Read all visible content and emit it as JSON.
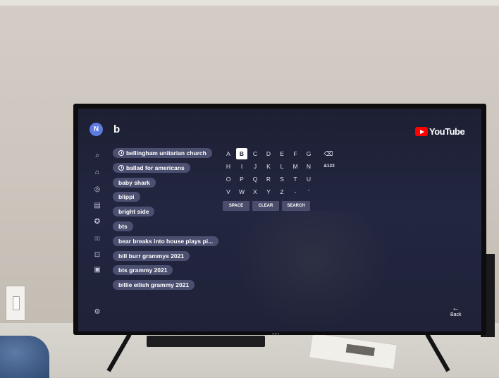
{
  "app": {
    "name": "YouTube",
    "avatar_initial": "N",
    "query": "b",
    "accent": "#ff0000"
  },
  "nav": [
    {
      "name": "search-icon",
      "glyph": "⌕"
    },
    {
      "name": "home-icon",
      "glyph": "⌂"
    },
    {
      "name": "explore-icon",
      "glyph": "◎"
    },
    {
      "name": "subscriptions-icon",
      "glyph": "▤"
    },
    {
      "name": "gaming-icon",
      "glyph": "✪"
    },
    {
      "name": "music-icon",
      "glyph": "▯▯"
    },
    {
      "name": "news-icon",
      "glyph": "⊡"
    },
    {
      "name": "library-icon",
      "glyph": "▣"
    },
    {
      "name": "settings-icon",
      "glyph": "⚙"
    }
  ],
  "suggestions": [
    {
      "text": "bellingham unitarian church",
      "history": true
    },
    {
      "text": "ballad for americans",
      "history": true
    },
    {
      "text": "baby shark",
      "history": false
    },
    {
      "text": "blippi",
      "history": false
    },
    {
      "text": "bright side",
      "history": false
    },
    {
      "text": "bts",
      "history": false
    },
    {
      "text": "bear breaks into house plays pi...",
      "history": false
    },
    {
      "text": "bill burr grammys 2021",
      "history": false
    },
    {
      "text": "bts grammy 2021",
      "history": false
    },
    {
      "text": "billie eilish grammy 2021",
      "history": false
    }
  ],
  "keyboard": {
    "rows": [
      [
        "A",
        "B",
        "C",
        "D",
        "E",
        "F",
        "G"
      ],
      [
        "H",
        "I",
        "J",
        "K",
        "L",
        "M",
        "N"
      ],
      [
        "O",
        "P",
        "Q",
        "R",
        "S",
        "T",
        "U"
      ],
      [
        "V",
        "W",
        "X",
        "Y",
        "Z",
        "-",
        "'"
      ]
    ],
    "selected": "B",
    "backspace_icon": "backspace-icon",
    "symbols_label": "&123",
    "space_label": "SPACE",
    "clear_label": "CLEAR",
    "search_label": "SEARCH"
  },
  "back": {
    "label": "Back",
    "icon": "back-arrow-icon"
  },
  "bezel_brand": "TCL"
}
